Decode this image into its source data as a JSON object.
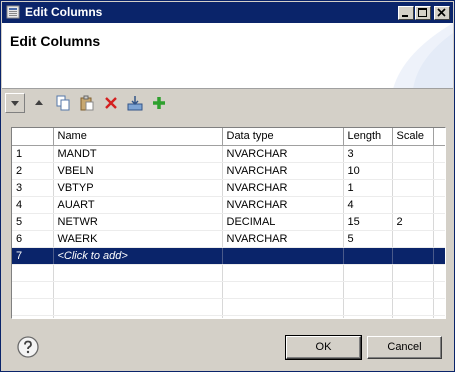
{
  "window": {
    "title": "Edit Columns"
  },
  "banner": {
    "title": "Edit Columns"
  },
  "toolbar": {
    "buttons": [
      {
        "icon": "move-down-icon"
      },
      {
        "icon": "move-up-icon"
      },
      {
        "icon": "copy-icon"
      },
      {
        "icon": "paste-icon"
      },
      {
        "icon": "delete-icon"
      },
      {
        "icon": "import-icon"
      },
      {
        "icon": "add-icon"
      }
    ]
  },
  "table": {
    "headers": [
      "",
      "Name",
      "Data type",
      "Length",
      "Scale"
    ],
    "rows": [
      [
        "1",
        "MANDT",
        "NVARCHAR",
        "3",
        ""
      ],
      [
        "2",
        "VBELN",
        "NVARCHAR",
        "10",
        ""
      ],
      [
        "3",
        "VBTYP",
        "NVARCHAR",
        "1",
        ""
      ],
      [
        "4",
        "AUART",
        "NVARCHAR",
        "4",
        ""
      ],
      [
        "5",
        "NETWR",
        "DECIMAL",
        "15",
        "2"
      ],
      [
        "6",
        "WAERK",
        "NVARCHAR",
        "5",
        ""
      ]
    ],
    "add_row": {
      "index": "7",
      "placeholder": "<Click to add>"
    }
  },
  "footer": {
    "ok_label": "OK",
    "cancel_label": "Cancel"
  },
  "colors": {
    "title_bar": "#0a246a",
    "selection": "#0a246a",
    "dialog_bg": "#d4d0c8"
  }
}
